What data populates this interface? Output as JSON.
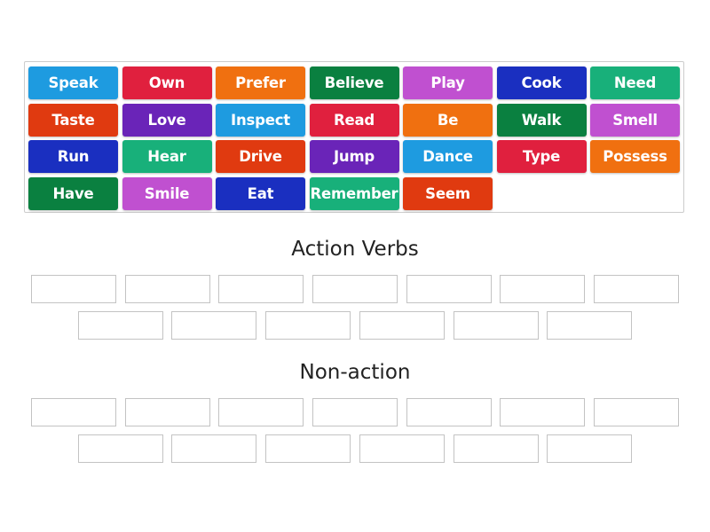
{
  "bank": {
    "tiles": [
      {
        "label": "Speak",
        "color": "#1e9be0"
      },
      {
        "label": "Own",
        "color": "#e0203e"
      },
      {
        "label": "Prefer",
        "color": "#f07010"
      },
      {
        "label": "Believe",
        "color": "#0a8040"
      },
      {
        "label": "Play",
        "color": "#c050d0"
      },
      {
        "label": "Cook",
        "color": "#1a2fc0"
      },
      {
        "label": "Need",
        "color": "#18b07a"
      },
      {
        "label": "Taste",
        "color": "#e03a10"
      },
      {
        "label": "Love",
        "color": "#6a24b8"
      },
      {
        "label": "Inspect",
        "color": "#1e9be0"
      },
      {
        "label": "Read",
        "color": "#e0203e"
      },
      {
        "label": "Be",
        "color": "#f07010"
      },
      {
        "label": "Walk",
        "color": "#0a8040"
      },
      {
        "label": "Smell",
        "color": "#c050d0"
      },
      {
        "label": "Run",
        "color": "#1a2fc0"
      },
      {
        "label": "Hear",
        "color": "#18b07a"
      },
      {
        "label": "Drive",
        "color": "#e03a10"
      },
      {
        "label": "Jump",
        "color": "#6a24b8"
      },
      {
        "label": "Dance",
        "color": "#1e9be0"
      },
      {
        "label": "Type",
        "color": "#e0203e"
      },
      {
        "label": "Possess",
        "color": "#f07010"
      },
      {
        "label": "Have",
        "color": "#0a8040"
      },
      {
        "label": "Smile",
        "color": "#c050d0"
      },
      {
        "label": "Eat",
        "color": "#1a2fc0"
      },
      {
        "label": "Remember",
        "color": "#18b07a"
      },
      {
        "label": "Seem",
        "color": "#e03a10"
      }
    ]
  },
  "groups": [
    {
      "title": "Action Verbs",
      "slot_count": 13
    },
    {
      "title": "Non-action",
      "slot_count": 13
    }
  ]
}
